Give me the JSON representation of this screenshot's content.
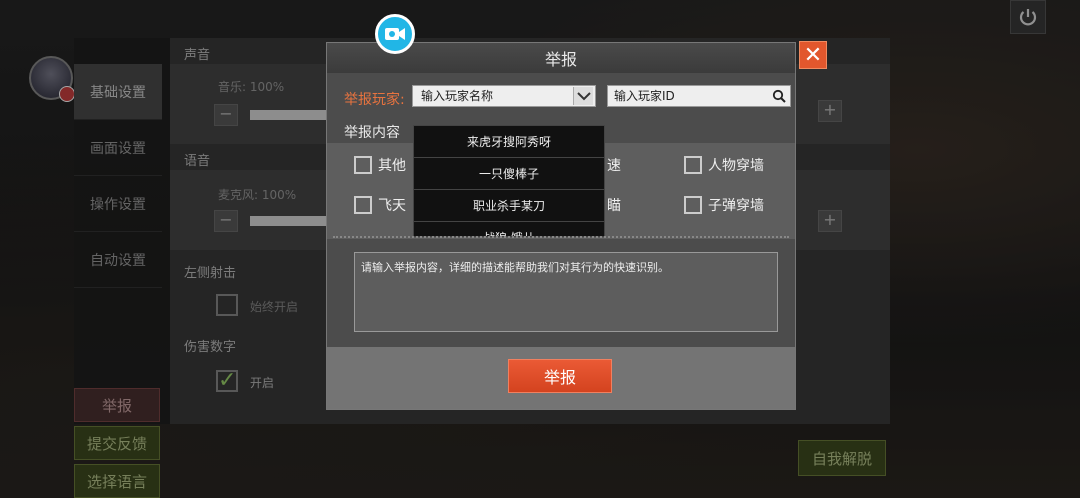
{
  "settings": {
    "nav": [
      "基础设置",
      "画面设置",
      "操作设置",
      "自动设置"
    ],
    "sound_title": "声音",
    "music_label": "音乐: 100%",
    "voice_title": "语音",
    "mic_label": "麦克风: 100%",
    "left_fire_title": "左侧射击",
    "always_on": "始终开启",
    "damage_title": "伤害数字",
    "on_label": "开启"
  },
  "side_buttons": {
    "report": "举报",
    "feedback": "提交反馈",
    "language": "选择语言",
    "unstuck": "自我解脱"
  },
  "modal": {
    "title": "举报",
    "report_player_label": "举报玩家:",
    "name_placeholder": "输入玩家名称",
    "id_placeholder": "输入玩家ID",
    "content_label": "举报内容",
    "options": [
      "其他",
      "飞天",
      "速",
      "瞄",
      "人物穿墙",
      "子弹穿墙"
    ],
    "dropdown_items": [
      "来虎牙搜阿秀呀",
      "一只傻棒子",
      "职业杀手某刀",
      "战狼 饿儿"
    ],
    "textarea_placeholder": "请输入举报内容，详细的描述能帮助我们对其行为的快速识别。",
    "submit_label": "举报"
  }
}
